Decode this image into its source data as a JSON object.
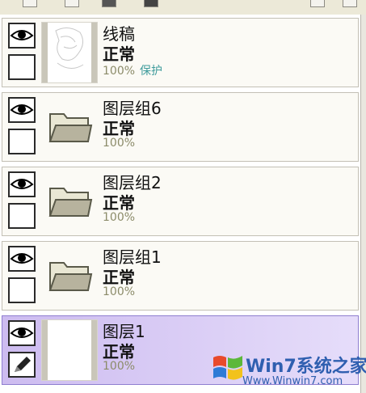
{
  "layers": [
    {
      "name": "线稿",
      "mode": "正常",
      "opacity": "100%",
      "protect": "保护",
      "kind": "layer",
      "selected": false
    },
    {
      "name": "图层组6",
      "mode": "正常",
      "opacity": "100%",
      "kind": "folder",
      "selected": false
    },
    {
      "name": "图层组2",
      "mode": "正常",
      "opacity": "100%",
      "kind": "folder",
      "selected": false
    },
    {
      "name": "图层组1",
      "mode": "正常",
      "opacity": "100%",
      "kind": "folder",
      "selected": false
    },
    {
      "name": "图层1",
      "mode": "正常",
      "opacity": "100%",
      "kind": "layer",
      "selected": true
    }
  ],
  "watermark": {
    "brand": "Win7系统之家",
    "url": "Www.Winwin7.com"
  },
  "colors": {
    "selected": "#cdbcf0",
    "protect": "#3f9c9c"
  }
}
